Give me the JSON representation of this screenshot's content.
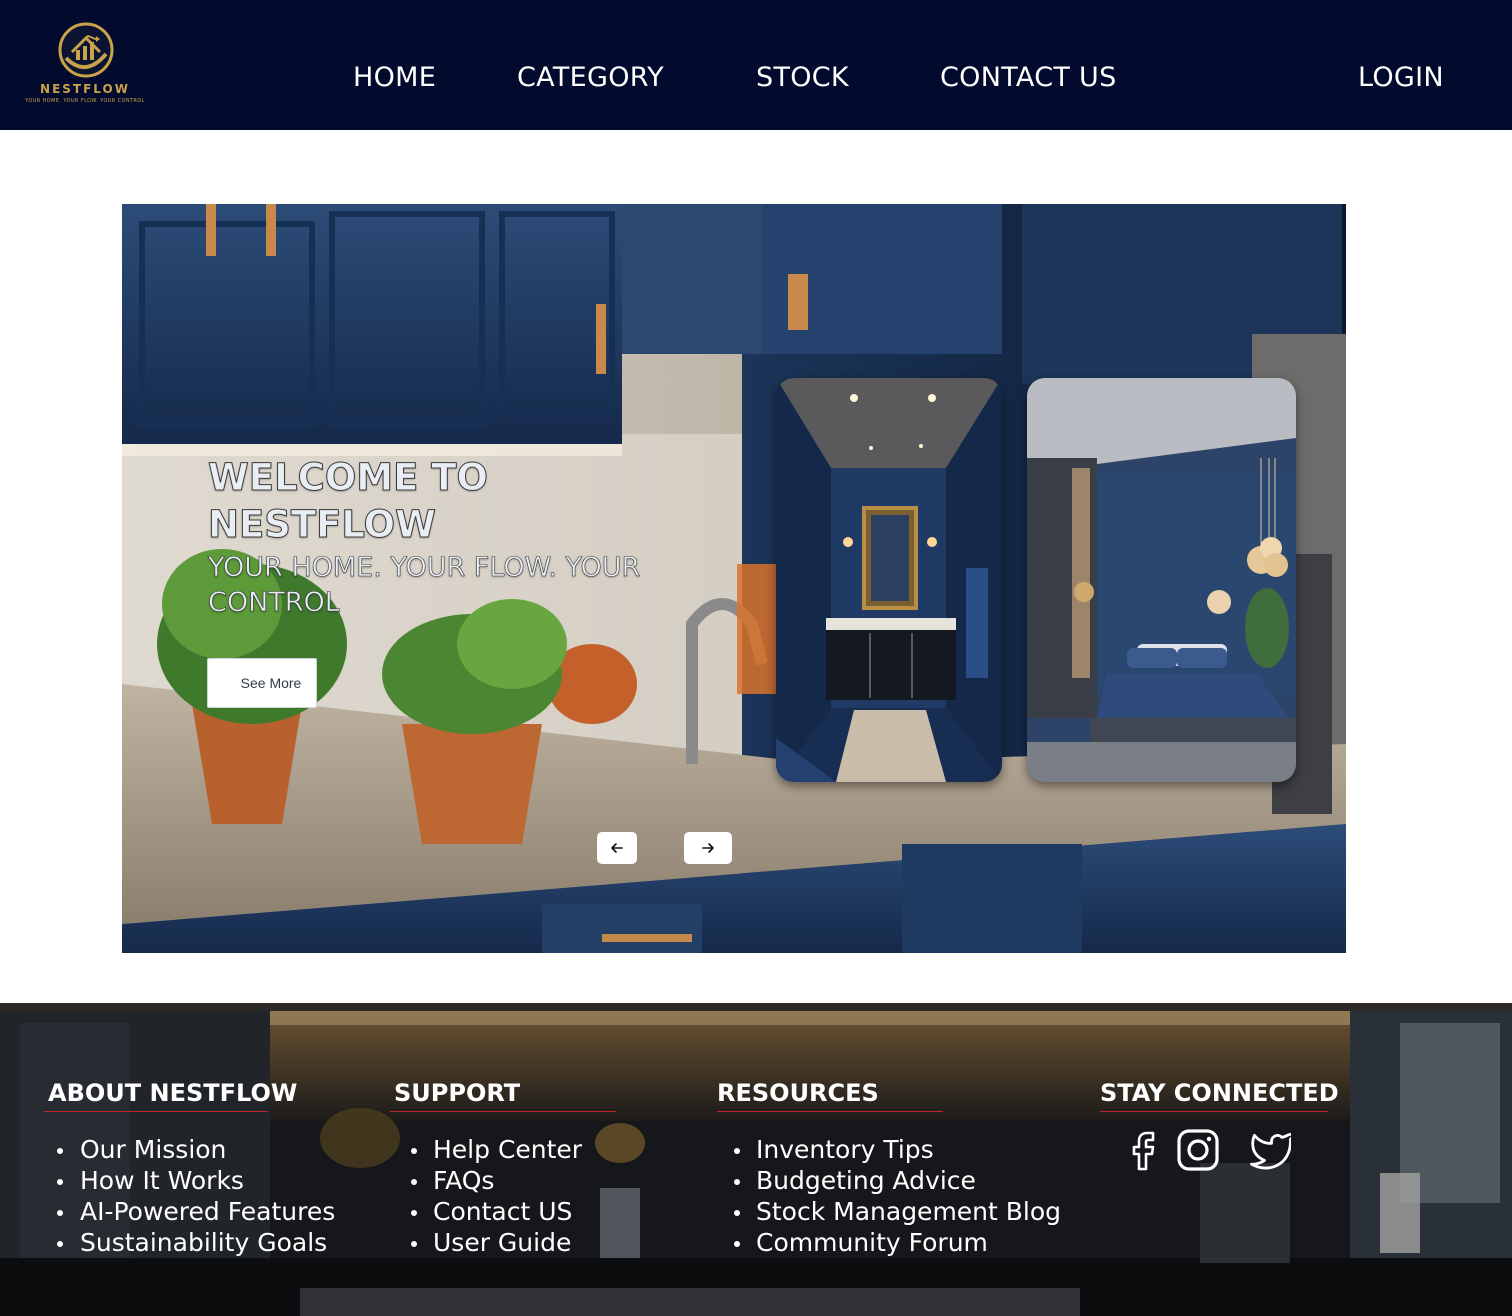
{
  "brand": {
    "name": "NESTFLOW",
    "tagline": "YOUR HOME. YOUR FLOW. YOUR CONTROL"
  },
  "nav": {
    "home": "HOME",
    "category": "CATEGORY",
    "stock": "STOCK",
    "contact": "CONTACT US",
    "login": "LOGIN"
  },
  "hero": {
    "title": "WELCOME TO NESTFLOW",
    "subtitle": "YOUR HOME. YOUR FLOW. YOUR CONTROL",
    "cta": "See More",
    "prev_icon": "arrow-left-icon",
    "next_icon": "arrow-right-icon"
  },
  "footer": {
    "about": {
      "heading": "ABOUT NESTFLOW",
      "items": [
        "Our Mission",
        "How It Works",
        "AI-Powered Features",
        "Sustainability Goals"
      ]
    },
    "support": {
      "heading": "SUPPORT",
      "items": [
        "Help Center",
        "FAQs",
        "Contact US",
        "User Guide"
      ]
    },
    "resources": {
      "heading": "RESOURCES",
      "items": [
        "Inventory Tips",
        "Budgeting Advice",
        "Stock Management Blog",
        "Community Forum"
      ]
    },
    "social": {
      "heading": "STAY CONNECTED",
      "icons": [
        "facebook-icon",
        "instagram-icon",
        "twitter-icon"
      ]
    }
  },
  "colors": {
    "navbar": "#020a2e",
    "gold": "#c9a24a",
    "heading_underline": "#c0272d",
    "navy_cabinet": "#1f3a63"
  }
}
